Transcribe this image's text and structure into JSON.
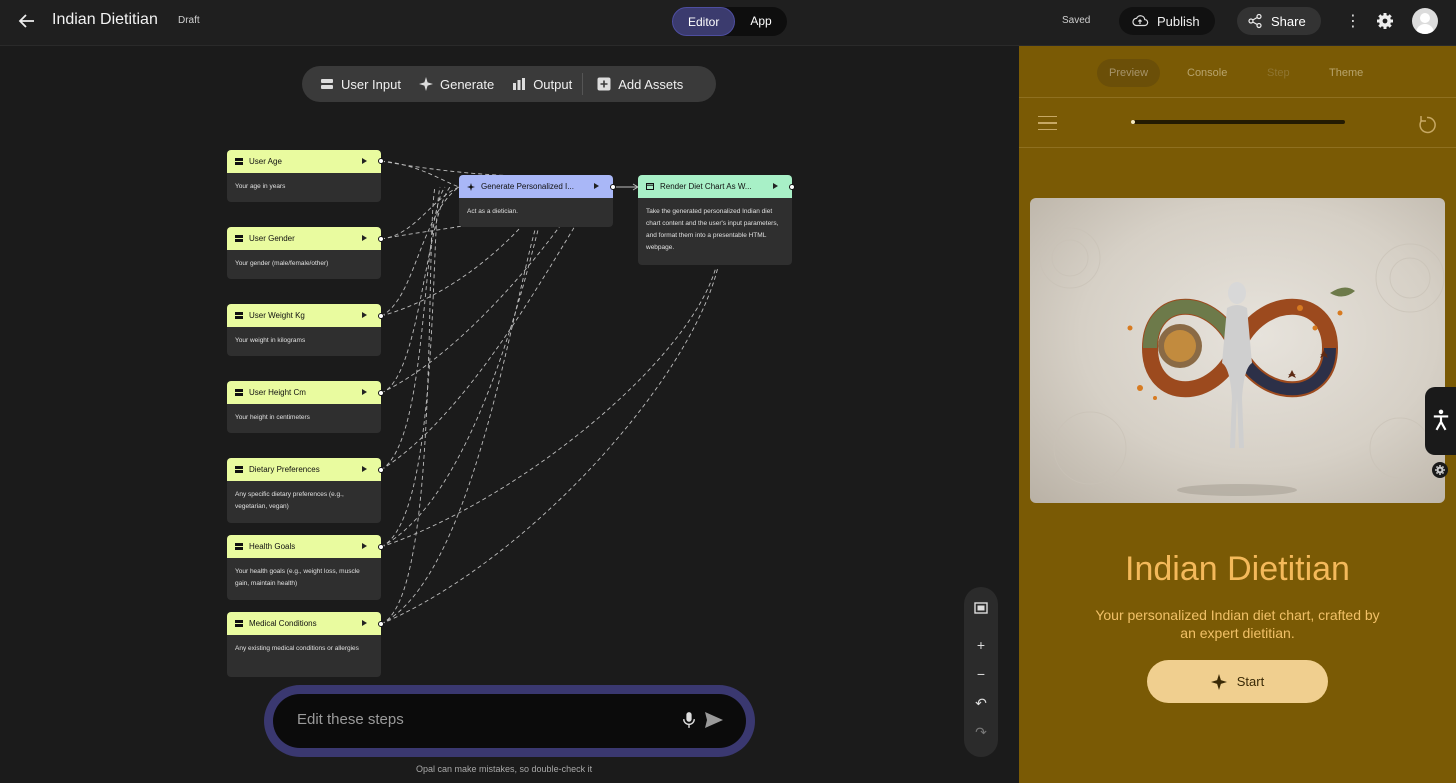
{
  "header": {
    "title": "Indian Dietitian",
    "status": "Draft",
    "modes": [
      "Editor",
      "App"
    ],
    "active_mode": "Editor",
    "save_state": "Saved",
    "publish_label": "Publish",
    "share_label": "Share"
  },
  "toolbar": {
    "items": [
      "User Input",
      "Generate",
      "Output",
      "Add Assets"
    ]
  },
  "nodes": {
    "user_age": {
      "title": "User Age",
      "desc": "Your age in years"
    },
    "user_gender": {
      "title": "User Gender",
      "desc": "Your gender (male/female/other)"
    },
    "user_weight": {
      "title": "User Weight Kg",
      "desc": "Your weight in kilograms"
    },
    "user_height": {
      "title": "User Height Cm",
      "desc": "Your height in centimeters"
    },
    "dietary": {
      "title": "Dietary Preferences",
      "desc": "Any specific dietary preferences (e.g., vegetarian, vegan)"
    },
    "health": {
      "title": "Health Goals",
      "desc": "Your health goals (e.g., weight loss, muscle gain, maintain health)"
    },
    "medical": {
      "title": "Medical Conditions",
      "desc": "Any existing medical conditions or allergies"
    },
    "generate": {
      "title": "Generate Personalized I...",
      "desc": "Act as a dietician."
    },
    "render": {
      "title": "Render Diet Chart As W...",
      "desc": "Take the generated personalized Indian diet chart content and the user's input parameters, and format them into a presentable HTML webpage."
    }
  },
  "edit": {
    "placeholder": "Edit these steps",
    "disclaimer": "Opal can make mistakes, so double-check it"
  },
  "preview": {
    "tabs": [
      "Preview",
      "Console",
      "Step",
      "Theme"
    ],
    "active_tab": "Preview",
    "progress": 0.02,
    "title": "Indian Dietitian",
    "subtitle": "Your personalized Indian diet chart, crafted by an expert dietitian.",
    "start_label": "Start"
  },
  "colors": {
    "input_node": "#e9fb9f",
    "generate_node": "#a9b7f7",
    "output_node": "#a8f0c7",
    "panel_bg": "#7a5a05",
    "title_accent": "#f4b95a"
  }
}
